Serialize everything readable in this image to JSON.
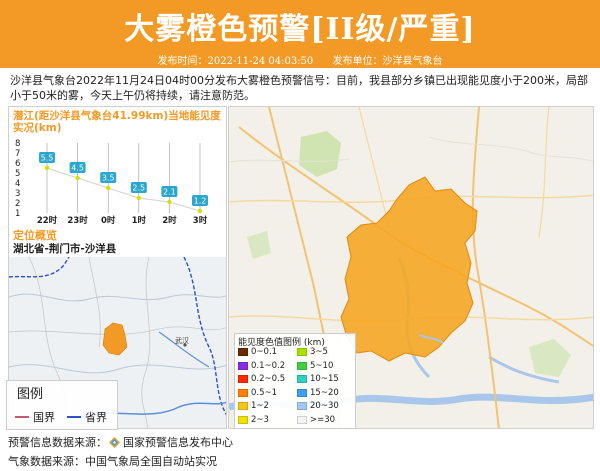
{
  "header": {
    "title": "大雾橙色预警[II级/严重]",
    "publish_time_label": "发布时间：2022-11-24 04:03:50",
    "publisher_label": "发布单位：沙洋县气象台",
    "background_color": "#f39a26"
  },
  "body_text": "沙洋县气象台2022年11月24日04时00分发布大雾橙色预警信号：目前，我县部分乡镇已出现能见度小于200米，局部小于50米的雾，今天上午仍将持续，请注意防范。",
  "chart": {
    "title": "潜江(距沙洋县气象台41.99km)当地能见度实况(km)"
  },
  "chart_data": {
    "type": "line",
    "title": "潜江(距沙洋县气象台41.99km)当地能见度实况(km)",
    "categories": [
      "22时",
      "23时",
      "0时",
      "1时",
      "2时",
      "3时"
    ],
    "series": [
      {
        "values": [
          5.5,
          4.5,
          3.5,
          2.5,
          2.1,
          1.2
        ]
      }
    ],
    "y_ticks": [
      "1",
      "2",
      "3",
      "4",
      "5",
      "6",
      "7",
      "8"
    ],
    "ylim": [
      1,
      8
    ],
    "grid": "vertical",
    "line_color": "#d9d9d9",
    "point_color": "#d6e000",
    "label_bg_color": "#2aa6cf"
  },
  "location": {
    "title": "定位概览",
    "name": "湖北省-荆门市-沙洋县"
  },
  "mini_map": {
    "city_label": "武汉",
    "highlight_color": "#f39a26"
  },
  "map_legend": {
    "title": "图例",
    "items": [
      {
        "label": "国界",
        "color": "#c05a6e"
      },
      {
        "label": "省界",
        "color": "#2c52c9"
      }
    ]
  },
  "main_map": {
    "highlight_color": "#f5a623"
  },
  "visibility_legend": {
    "title": "能见度色值图例 (km)",
    "left_items": [
      {
        "label": "0~0.1",
        "color": "#6b2a00"
      },
      {
        "label": "0.1~0.2",
        "color": "#8a2be2"
      },
      {
        "label": "0.2~0.5",
        "color": "#ff2a00"
      },
      {
        "label": "0.5~1",
        "color": "#ff7f00"
      },
      {
        "label": "1~2",
        "color": "#f5c518"
      },
      {
        "label": "2~3",
        "color": "#f0e000"
      }
    ],
    "right_items": [
      {
        "label": "3~5",
        "color": "#a8e000"
      },
      {
        "label": "5~10",
        "color": "#40d040"
      },
      {
        "label": "10~15",
        "color": "#30d0c0"
      },
      {
        "label": "15~20",
        "color": "#40a0f0"
      },
      {
        "label": "20~30",
        "color": "#a0c8f0"
      },
      {
        "label": ">=30",
        "color": "#f4f4f4"
      }
    ]
  },
  "footer": {
    "warning_source_label": "预警信息数据来源：",
    "warning_source_value": "国家预警信息发布中心",
    "weather_source_label": "气象数据来源：",
    "weather_source_value": "中国气象局全国自动站实况"
  }
}
